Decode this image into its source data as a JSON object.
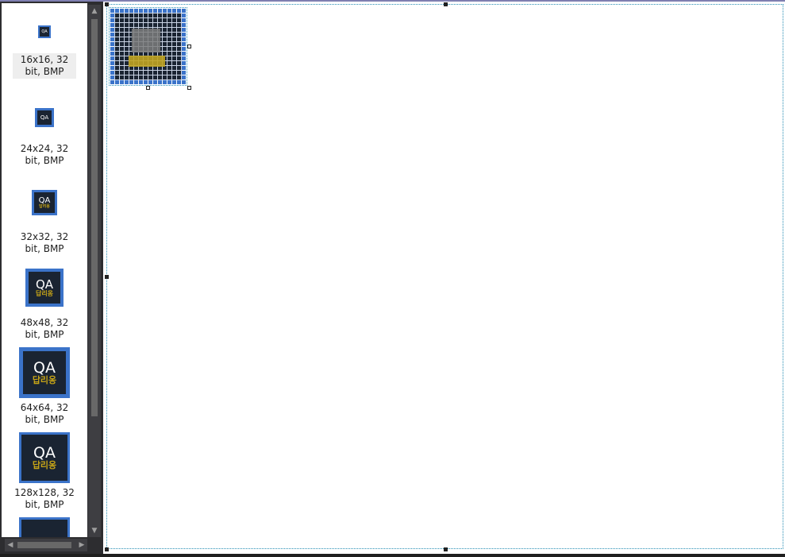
{
  "image_list": {
    "entries": [
      {
        "label": "16x16, 32 bit, BMP",
        "qa": "QA",
        "kr": ""
      },
      {
        "label": "24x24, 32 bit, BMP",
        "qa": "QA",
        "kr": ""
      },
      {
        "label": "32x32, 32 bit, BMP",
        "qa": "QA",
        "kr": "답리옹"
      },
      {
        "label": "48x48, 32 bit, BMP",
        "qa": "QA",
        "kr": "답리옹"
      },
      {
        "label": "64x64, 32 bit, BMP",
        "qa": "QA",
        "kr": "답리옹"
      },
      {
        "label": "128x128, 32 bit, BMP",
        "qa": "QA",
        "kr": "답리옹"
      }
    ],
    "selected_index": 0
  },
  "editor": {
    "selected_image": "16x16, 32 bit, BMP"
  },
  "colors": {
    "icon_border": "#3b73c9",
    "icon_background": "#1a2432",
    "icon_gold_text": "#c7a517",
    "selection_dots": "#2a8fb5"
  },
  "icons": {
    "scroll_up": "▲",
    "scroll_down": "▼",
    "scroll_left": "◀",
    "scroll_right": "▶"
  }
}
